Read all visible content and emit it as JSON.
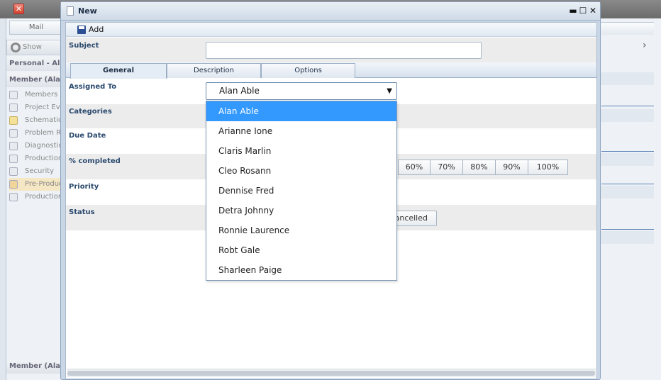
{
  "background": {
    "close_glyph": "✕",
    "mail_label": "Mail",
    "show_label": "Show",
    "sections": [
      "Personal - Alan",
      "Member (Alan",
      "Member (Alan"
    ],
    "items": [
      "Members",
      "Project Eve",
      "Schematics",
      "Problem Re",
      "Diagnostics",
      "Production",
      "Security",
      "Pre-Produc",
      "Production"
    ],
    "right_arrow": "›"
  },
  "dialog": {
    "title": "New",
    "controls": {
      "minimize": "▬",
      "maximize": "☐",
      "close": "✕"
    },
    "toolbar": {
      "add_label": "Add"
    },
    "subject_label": "Subject",
    "tabs": [
      "General",
      "Description",
      "Options"
    ],
    "labels": {
      "assigned_to": "Assigned To",
      "categories": "Categories",
      "due_date": "Due Date",
      "percent_completed": "% completed",
      "priority": "Priority",
      "status": "Status"
    },
    "assigned_to_value": "Alan Able",
    "assigned_to_arrow": "▼",
    "percent_options": [
      "60%",
      "70%",
      "80%",
      "90%",
      "100%"
    ],
    "status_visible": "Cancelled",
    "dropdown_options": [
      "Alan Able",
      "Arianne Ione",
      "Claris Marlin",
      "Cleo Rosann",
      "Dennise Fred",
      "Detra Johnny",
      "Ronnie Laurence",
      "Robt Gale",
      "Sharleen Paige"
    ]
  },
  "colors": {
    "selection": "#3399ff",
    "label": "#2b4a6e"
  }
}
